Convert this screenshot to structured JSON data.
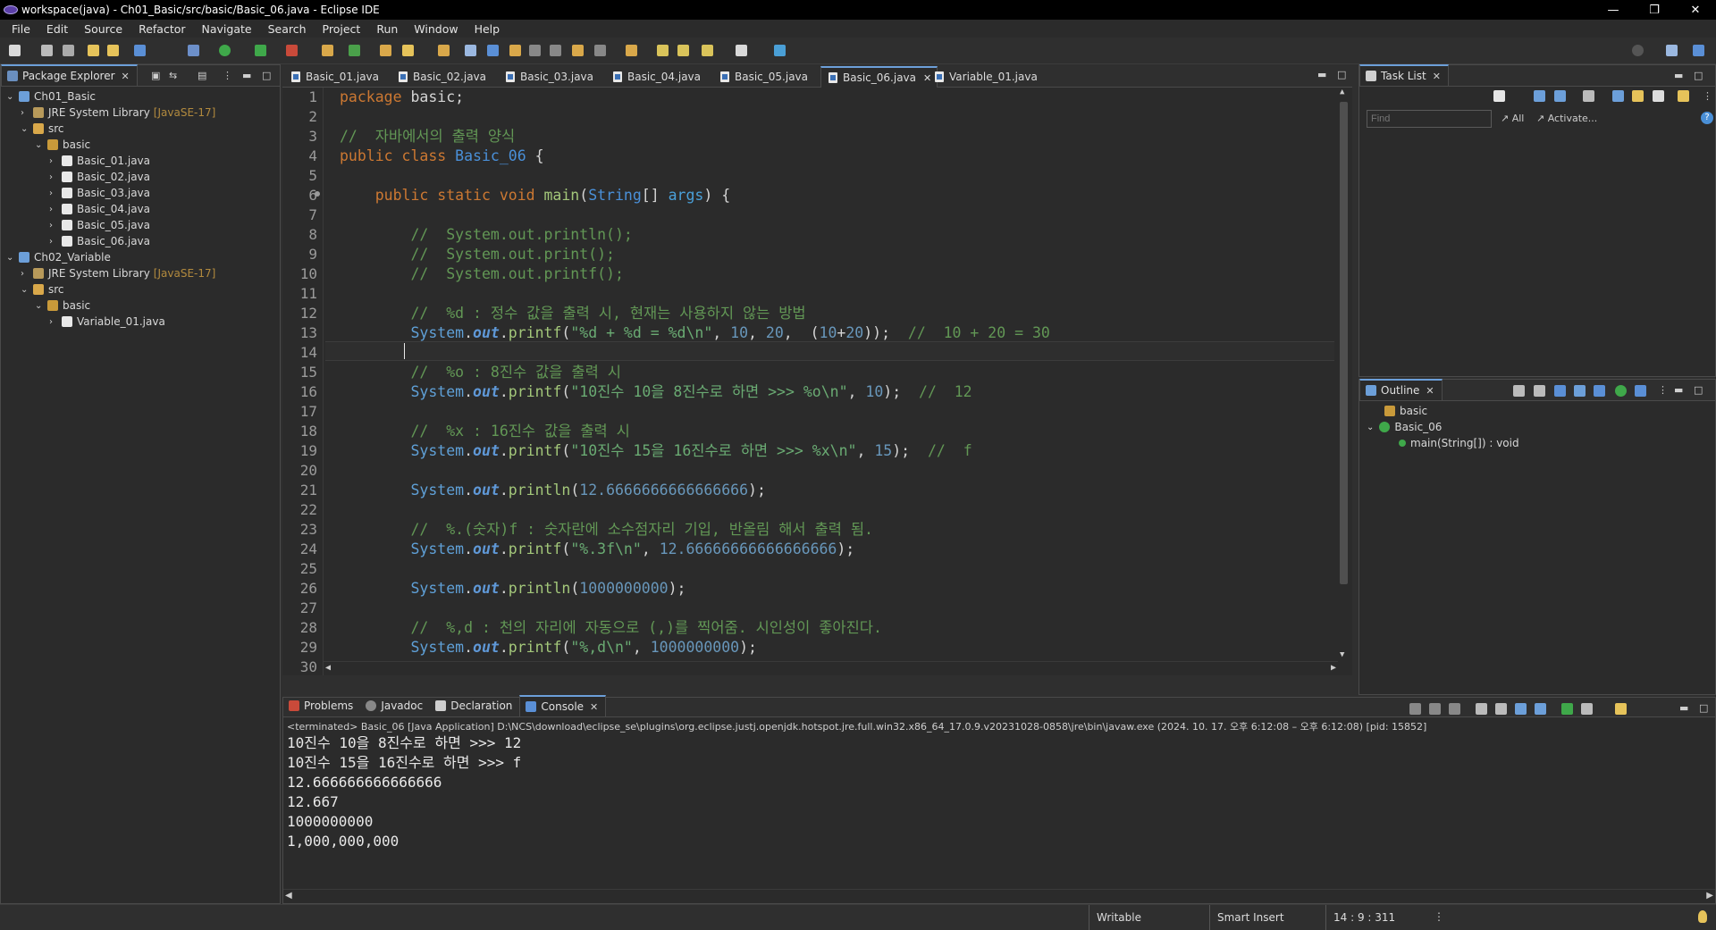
{
  "window": {
    "title": "workspace(java) - Ch01_Basic/src/basic/Basic_06.java - Eclipse IDE",
    "minimize": "—",
    "restore": "❐",
    "close": "✕"
  },
  "menu": [
    "File",
    "Edit",
    "Source",
    "Refactor",
    "Navigate",
    "Search",
    "Project",
    "Run",
    "Window",
    "Help"
  ],
  "package_explorer": {
    "tab": "Package Explorer",
    "tree": [
      {
        "label": "Ch01_Basic",
        "depth": 0,
        "twisty": "⌄",
        "icon": "project-icon"
      },
      {
        "label": "JRE System Library",
        "extra": "[JavaSE-17]",
        "depth": 1,
        "twisty": "›",
        "icon": "library-icon"
      },
      {
        "label": "src",
        "depth": 1,
        "twisty": "⌄",
        "icon": "folder-icon"
      },
      {
        "label": "basic",
        "depth": 2,
        "twisty": "⌄",
        "icon": "package-icon"
      },
      {
        "label": "Basic_01.java",
        "depth": 3,
        "twisty": "›",
        "icon": "java-file-icon"
      },
      {
        "label": "Basic_02.java",
        "depth": 3,
        "twisty": "›",
        "icon": "java-file-icon"
      },
      {
        "label": "Basic_03.java",
        "depth": 3,
        "twisty": "›",
        "icon": "java-file-icon"
      },
      {
        "label": "Basic_04.java",
        "depth": 3,
        "twisty": "›",
        "icon": "java-file-icon"
      },
      {
        "label": "Basic_05.java",
        "depth": 3,
        "twisty": "›",
        "icon": "java-file-icon"
      },
      {
        "label": "Basic_06.java",
        "depth": 3,
        "twisty": "›",
        "icon": "java-file-icon"
      },
      {
        "label": "Ch02_Variable",
        "depth": 0,
        "twisty": "⌄",
        "icon": "project-icon"
      },
      {
        "label": "JRE System Library",
        "extra": "[JavaSE-17]",
        "depth": 1,
        "twisty": "›",
        "icon": "library-icon"
      },
      {
        "label": "src",
        "depth": 1,
        "twisty": "⌄",
        "icon": "folder-icon"
      },
      {
        "label": "basic",
        "depth": 2,
        "twisty": "⌄",
        "icon": "package-icon"
      },
      {
        "label": "Variable_01.java",
        "depth": 3,
        "twisty": "›",
        "icon": "java-file-icon"
      }
    ]
  },
  "editor_tabs": [
    "Basic_01.java",
    "Basic_02.java",
    "Basic_03.java",
    "Basic_04.java",
    "Basic_05.java",
    "Basic_06.java",
    "Variable_01.java"
  ],
  "active_editor_tab": "Basic_06.java",
  "line_numbers": [
    "1",
    "2",
    "3",
    "4",
    "5",
    "6",
    "7",
    "8",
    "9",
    "10",
    "11",
    "12",
    "13",
    "14",
    "15",
    "16",
    "17",
    "18",
    "19",
    "20",
    "21",
    "22",
    "23",
    "24",
    "25",
    "26",
    "27",
    "28",
    "29",
    "30"
  ],
  "code": [
    {
      "n": 1,
      "html": "<span class=\"kw\">package</span> basic;"
    },
    {
      "n": 2,
      "html": ""
    },
    {
      "n": 3,
      "html": "<span class=\"cm\">//  자바에서의 출력 양식</span>"
    },
    {
      "n": 4,
      "html": "<span class=\"kw\">public class</span> <span class=\"cls\">Basic_06</span> {"
    },
    {
      "n": 5,
      "html": ""
    },
    {
      "n": 6,
      "html": "    <span class=\"kw\">public static void</span> <span class=\"fn\">main</span>(<span class=\"cls\">String</span>[] <span class=\"par\">args</span>) {"
    },
    {
      "n": 7,
      "html": ""
    },
    {
      "n": 8,
      "html": "        <span class=\"cm\">//  System.out.println();</span>"
    },
    {
      "n": 9,
      "html": "        <span class=\"cm\">//  System.out.print();</span>"
    },
    {
      "n": 10,
      "html": "        <span class=\"cm\">//  System.out.printf();</span>"
    },
    {
      "n": 11,
      "html": ""
    },
    {
      "n": 12,
      "html": "        <span class=\"cm\">//  %d : 정수 값을 출력 시, 현재는 사용하지 않는 방법</span>"
    },
    {
      "n": 13,
      "html": "        <span class=\"sys\">System</span>.<span class=\"fld\">out</span>.<span class=\"fn\">printf</span>(<span class=\"str\">\"%d + %d = %d\\n\"</span>, <span class=\"num\">10</span>, <span class=\"num\">20</span>,  (<span class=\"num\">10</span>+<span class=\"num\">20</span>));  <span class=\"cm\">//  10 + 20 = 30</span>"
    },
    {
      "n": 14,
      "html": "        "
    },
    {
      "n": 15,
      "html": "        <span class=\"cm\">//  %o : 8진수 값을 출력 시</span>"
    },
    {
      "n": 16,
      "html": "        <span class=\"sys\">System</span>.<span class=\"fld\">out</span>.<span class=\"fn\">printf</span>(<span class=\"str\">\"10진수 10을 8진수로 하면 >>> %o\\n\"</span>, <span class=\"num\">10</span>);  <span class=\"cm\">//  12</span>"
    },
    {
      "n": 17,
      "html": ""
    },
    {
      "n": 18,
      "html": "        <span class=\"cm\">//  %x : 16진수 값을 출력 시</span>"
    },
    {
      "n": 19,
      "html": "        <span class=\"sys\">System</span>.<span class=\"fld\">out</span>.<span class=\"fn\">printf</span>(<span class=\"str\">\"10진수 15을 16진수로 하면 >>> %x\\n\"</span>, <span class=\"num\">15</span>);  <span class=\"cm\">//  f</span>"
    },
    {
      "n": 20,
      "html": ""
    },
    {
      "n": 21,
      "html": "        <span class=\"sys\">System</span>.<span class=\"fld\">out</span>.<span class=\"fn\">println</span>(<span class=\"num\">12.6666666666666666</span>);"
    },
    {
      "n": 22,
      "html": ""
    },
    {
      "n": 23,
      "html": "        <span class=\"cm\">//  %.(숫자)f : 숫자란에 소수점자리 기입, 반올림 해서 출력 됨.</span>"
    },
    {
      "n": 24,
      "html": "        <span class=\"sys\">System</span>.<span class=\"fld\">out</span>.<span class=\"fn\">printf</span>(<span class=\"str\">\"%.3f\\n\"</span>, <span class=\"num\">12.66666666666666666</span>);"
    },
    {
      "n": 25,
      "html": ""
    },
    {
      "n": 26,
      "html": "        <span class=\"sys\">System</span>.<span class=\"fld\">out</span>.<span class=\"fn\">println</span>(<span class=\"num\">1000000000</span>);"
    },
    {
      "n": 27,
      "html": ""
    },
    {
      "n": 28,
      "html": "        <span class=\"cm\">//  %,d : 천의 자리에 자동으로 (,)를 찍어줌. 시인성이 좋아진다.</span>"
    },
    {
      "n": 29,
      "html": "        <span class=\"sys\">System</span>.<span class=\"fld\">out</span>.<span class=\"fn\">printf</span>(<span class=\"str\">\"%,d\\n\"</span>, <span class=\"num\">1000000000</span>);"
    },
    {
      "n": 30,
      "html": ""
    }
  ],
  "task_list": {
    "tab": "Task List",
    "find_placeholder": "Find",
    "all": "All",
    "activate": "Activate..."
  },
  "outline": {
    "tab": "Outline",
    "items": [
      "basic",
      "Basic_06",
      "main(String[]) : void"
    ]
  },
  "bottom_tabs": [
    "Problems",
    "Javadoc",
    "Declaration",
    "Console"
  ],
  "active_bottom_tab": "Console",
  "console": {
    "header": "<terminated> Basic_06 [Java Application] D:\\NCS\\download\\eclipse_se\\plugins\\org.eclipse.justj.openjdk.hotspot.jre.full.win32.x86_64_17.0.9.v20231028-0858\\jre\\bin\\javaw.exe  (2024. 10. 17. 오후 6:12:08 – 오후 6:12:08) [pid: 15852]",
    "lines": [
      "10진수 10을 8진수로 하면 >>> 12",
      "10진수 15을 16진수로 하면 >>> f",
      "12.666666666666666",
      "12.667",
      "1000000000",
      "1,000,000,000"
    ]
  },
  "status": {
    "writable": "Writable",
    "insert_mode": "Smart Insert",
    "position": "14 : 9 : 311"
  },
  "colors": {
    "accent": "#6c9fd9",
    "keyword": "#cc7832",
    "comment": "#629755",
    "string": "#6aab73",
    "number": "#6897bb"
  }
}
